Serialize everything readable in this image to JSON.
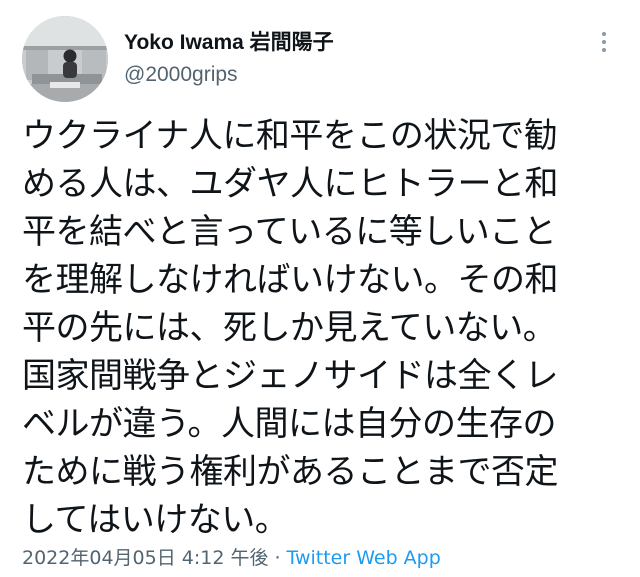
{
  "author": {
    "display_name": "Yoko Iwama 岩間陽子",
    "handle": "@2000grips"
  },
  "icons": {
    "more": "more-vertical-icon",
    "avatar": "profile-photo"
  },
  "tweet": {
    "lines": [
      "ウクライナ人に和平をこの状況で勧",
      "める人は、ユダヤ人にヒトラーと和",
      "平を結べと言っているに等しいこと",
      "を理解しなければいけない。その和",
      "平の先には、死しか見えていない。",
      "国家間戦争とジェノサイドは全くレ",
      "ベルが違う。人間には自分の生存の",
      "ために戦う権利があることまで否定",
      "してはいけない。"
    ]
  },
  "meta": {
    "timestamp": "2022年04月05日 4:12 午後",
    "separator": "·",
    "source": "Twitter Web App"
  },
  "colors": {
    "text": "#0f1419",
    "secondary": "#536471",
    "link": "#1d9bf0"
  }
}
